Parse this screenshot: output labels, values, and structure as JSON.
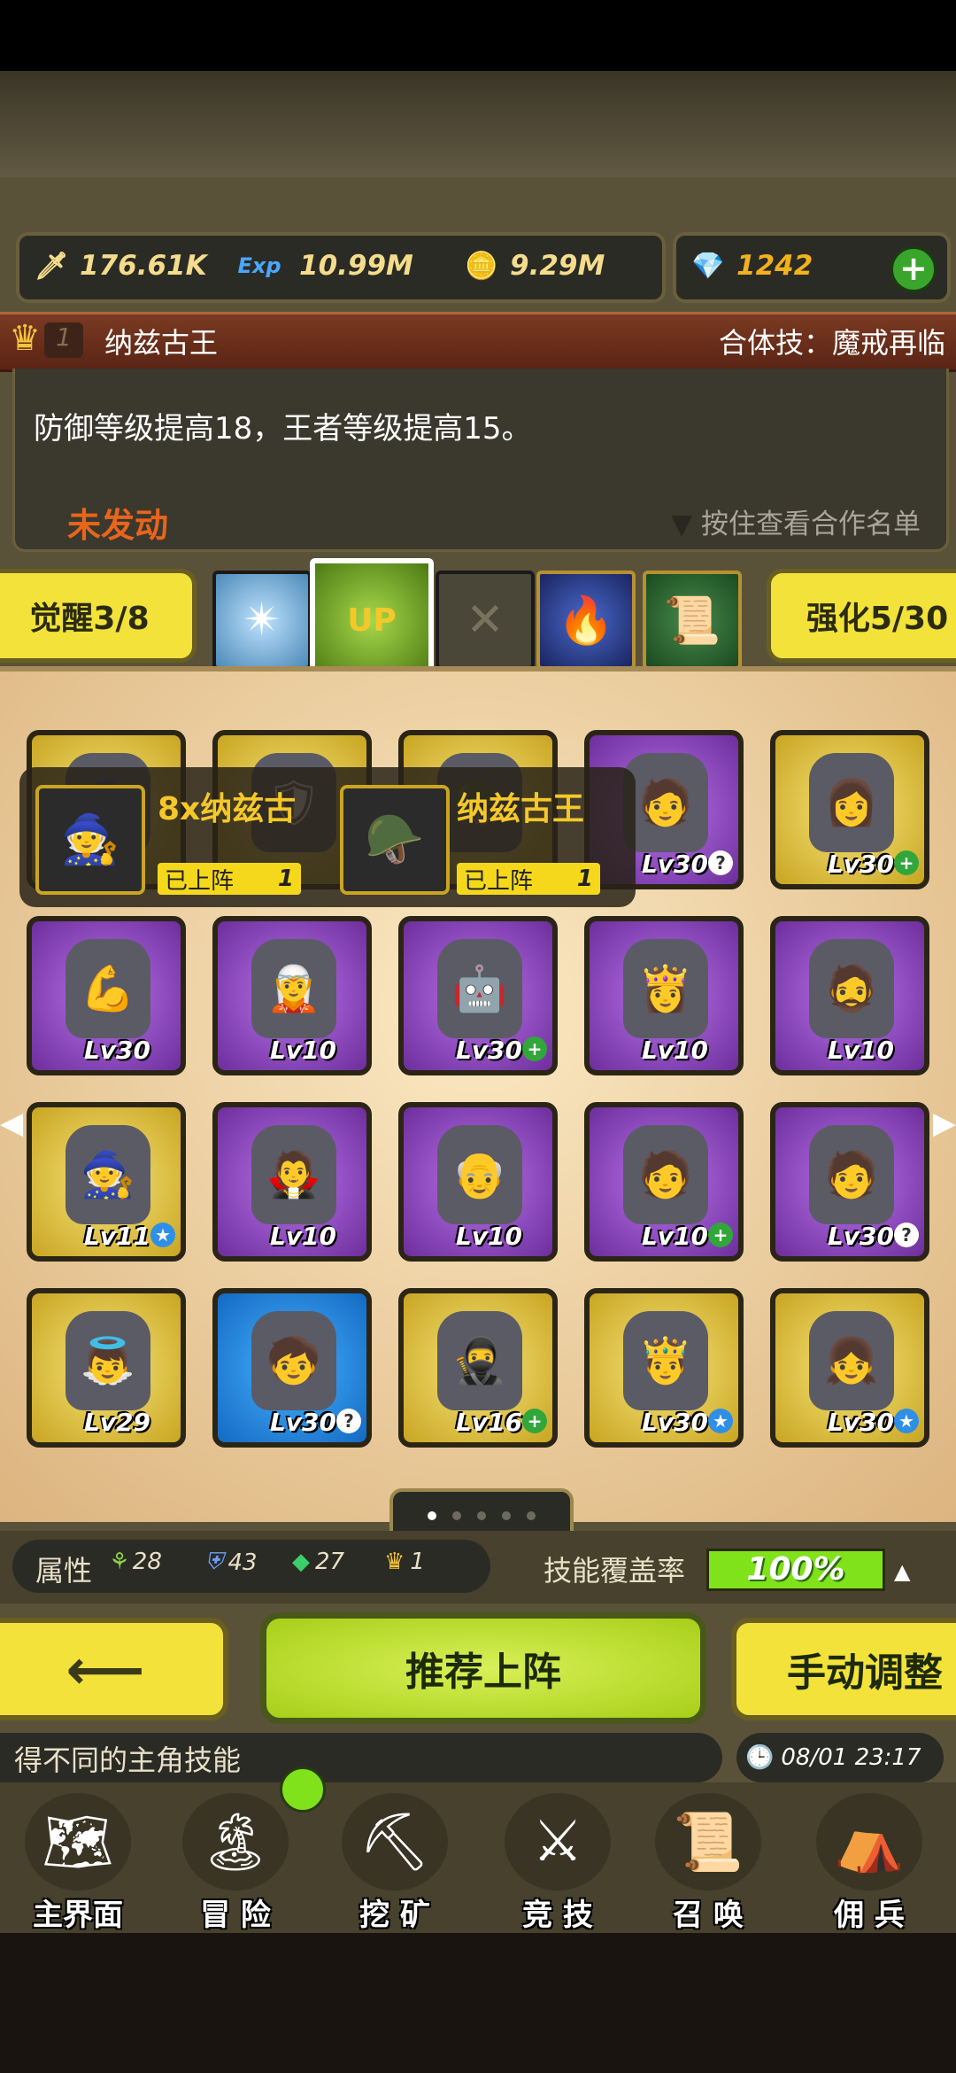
{
  "resources": {
    "attack": "176.61K",
    "exp": "10.99M",
    "gold": "9.29M",
    "gems": "1242",
    "exp_label": "Exp"
  },
  "hero": {
    "level": "1",
    "name": "纳兹古王",
    "combo": "合体技：魔戒再临",
    "description": "防御等级提高18，王者等级提高15。",
    "status": "未发动",
    "hint": "按住查看合作名单"
  },
  "awakening_label": "觉醒3/8",
  "enhance_label": "强化5/30",
  "skill_up_label": "UP",
  "tooltip": [
    {
      "title": "8x纳兹古",
      "status": "已上阵",
      "count": "1"
    },
    {
      "title": "纳兹古王",
      "status": "已上阵",
      "count": "1"
    }
  ],
  "heroes": [
    {
      "rarity": "gold",
      "level": "",
      "badge": "",
      "icon": "🧙"
    },
    {
      "rarity": "gold",
      "level": "",
      "badge": "",
      "icon": "🛡"
    },
    {
      "rarity": "gold",
      "level": "",
      "badge": "",
      "icon": "🪖"
    },
    {
      "rarity": "purple",
      "level": "Lv30",
      "badge": "?",
      "icon": "🧑"
    },
    {
      "rarity": "gold",
      "level": "Lv30",
      "badge": "+",
      "icon": "👩"
    },
    {
      "rarity": "purple",
      "level": "Lv30",
      "badge": "🔥",
      "icon": "💪"
    },
    {
      "rarity": "purple",
      "level": "Lv10",
      "badge": "🔥",
      "icon": "🧝"
    },
    {
      "rarity": "purple",
      "level": "Lv30",
      "badge": "+",
      "icon": "🤖"
    },
    {
      "rarity": "purple",
      "level": "Lv10",
      "badge": "🔥",
      "icon": "👸"
    },
    {
      "rarity": "purple",
      "level": "Lv10",
      "badge": "🔥",
      "icon": "🧔"
    },
    {
      "rarity": "gold",
      "level": "Lv11",
      "badge": "★",
      "icon": "🧙"
    },
    {
      "rarity": "purple",
      "level": "Lv10",
      "badge": "🔥",
      "icon": "🧛"
    },
    {
      "rarity": "purple",
      "level": "Lv10",
      "badge": "🔥",
      "icon": "👴"
    },
    {
      "rarity": "purple",
      "level": "Lv10",
      "badge": "+",
      "icon": "🧑"
    },
    {
      "rarity": "purple",
      "level": "Lv30",
      "badge": "?",
      "icon": "🧑"
    },
    {
      "rarity": "gold",
      "level": "Lv29",
      "badge": "🔥",
      "icon": "👼"
    },
    {
      "rarity": "blue",
      "level": "Lv30",
      "badge": "?",
      "icon": "🧒"
    },
    {
      "rarity": "gold",
      "level": "Lv16",
      "badge": "+",
      "icon": "🥷"
    },
    {
      "rarity": "gold",
      "level": "Lv30",
      "badge": "★",
      "icon": "🤴"
    },
    {
      "rarity": "gold",
      "level": "Lv30",
      "badge": "★",
      "icon": "👧"
    }
  ],
  "attributes": {
    "label": "属性",
    "values": [
      "28",
      "43",
      "27",
      "1"
    ],
    "coverage_label": "技能覆盖率",
    "coverage_value": "100%",
    "coverage_percent": 100
  },
  "buttons": {
    "recommend": "推荐上阵",
    "manual": "手动调整"
  },
  "ticker": "得不同的主角技能",
  "time": "08/01 23:17",
  "nav": [
    "主界面",
    "冒 险",
    "挖 矿",
    "竞 技",
    "召 唤",
    "佣 兵"
  ]
}
